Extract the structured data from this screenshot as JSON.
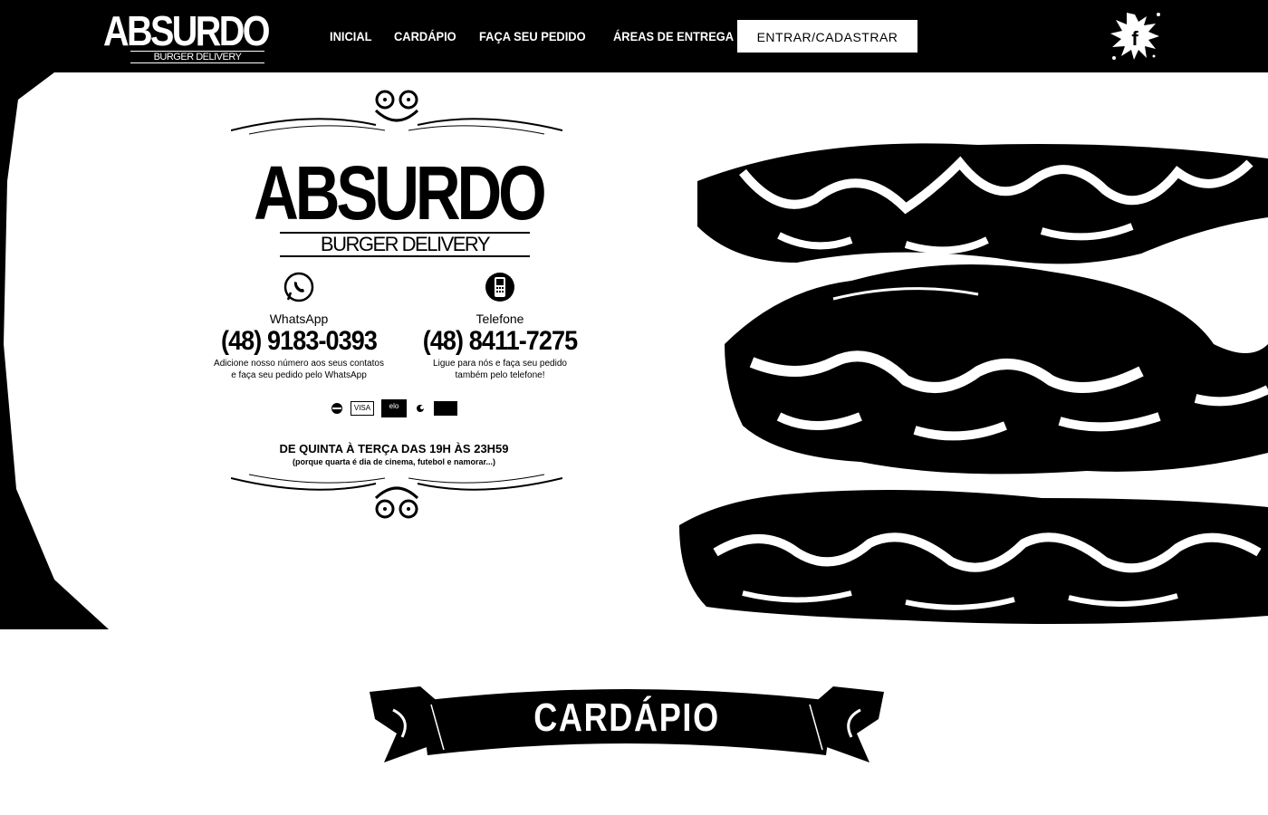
{
  "header": {
    "logo_word": "ABSURDO",
    "logo_sub": "BURGER DELIVERY",
    "nav": [
      {
        "label": "INICIAL"
      },
      {
        "label": "CARDÁPIO"
      },
      {
        "label": "FAÇA SEU PEDIDO"
      },
      {
        "label": "ÁREAS DE ENTREGA"
      }
    ],
    "login_label": "ENTRAR/CADASTRAR",
    "facebook_icon": "facebook-splat-icon"
  },
  "hero": {
    "logo_word": "ABSURDO",
    "logo_sub": "BURGER DELIVERY",
    "whatsapp": {
      "icon": "whatsapp-icon",
      "label": "WhatsApp",
      "number": "(48) 9183-0393",
      "description_line1": "Adicione nosso número aos seus contatos",
      "description_line2": "e faça seu pedido pelo WhatsApp"
    },
    "phone": {
      "icon": "phone-icon",
      "label": "Telefone",
      "number": "(48) 8411-7275",
      "description_line1": "Ligue para nós e faça seu pedido",
      "description_line2": "também pelo telefone!"
    },
    "payment_cards": [
      "",
      "VISA",
      "elo",
      "",
      ""
    ],
    "hours": "DE QUINTA À TERÇA DAS 19H ÀS 23H59",
    "hours_note": "(porque quarta é dia de cinema, futebol e namorar...)"
  },
  "menu_section": {
    "title": "CARDÁPIO"
  },
  "colors": {
    "background": "#ffffff",
    "bar": "#000000",
    "text": "#000000"
  }
}
